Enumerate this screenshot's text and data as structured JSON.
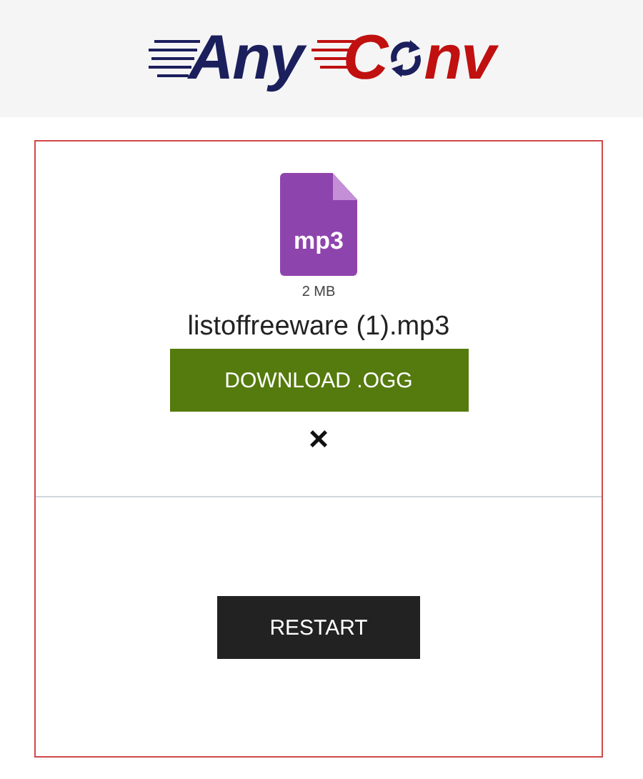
{
  "logo": {
    "part_1": "Any",
    "part_2": "C",
    "part_3": "nv"
  },
  "file": {
    "type": "mp3",
    "size": "2 MB",
    "name": "listoffreeware (1).mp3"
  },
  "download_button": "DOWNLOAD .OGG",
  "remove": "×",
  "restart_button": "RESTART"
}
